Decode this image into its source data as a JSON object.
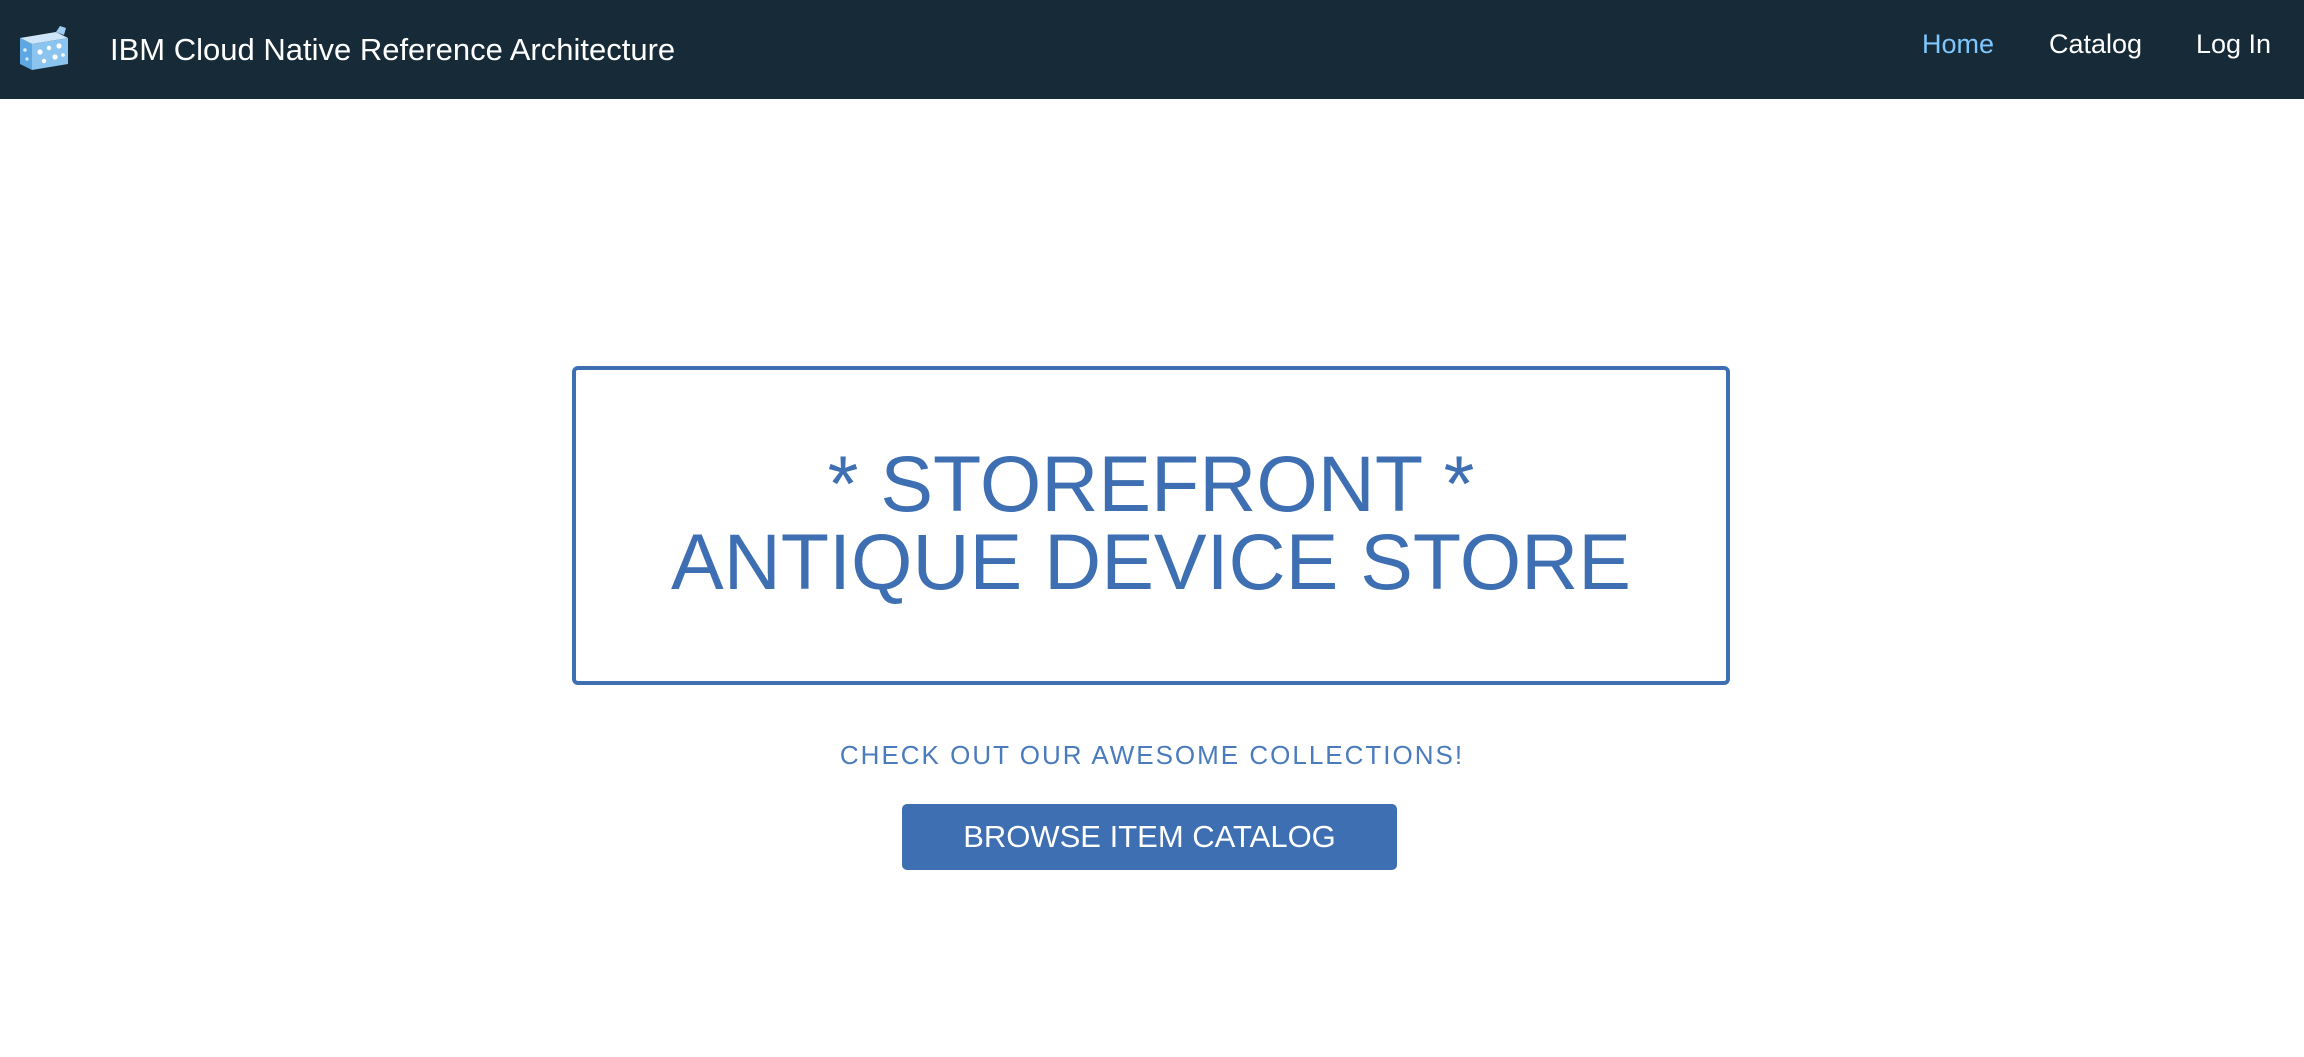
{
  "header": {
    "logo_icon": "store-cube-logo-icon",
    "title": "IBM Cloud Native Reference Architecture",
    "nav": {
      "home": "Home",
      "catalog": "Catalog",
      "login": "Log In"
    },
    "active_nav": "home"
  },
  "hero": {
    "line1": "* STOREFRONT *",
    "line2": "ANTIQUE DEVICE STORE"
  },
  "tagline": "CHECK OUT OUR AWESOME COLLECTIONS!",
  "cta": {
    "label": "BROWSE ITEM CATALOG"
  },
  "colors": {
    "navbar_bg": "#172a37",
    "accent": "#3e6fb2",
    "active_link": "#7ec8ff"
  }
}
